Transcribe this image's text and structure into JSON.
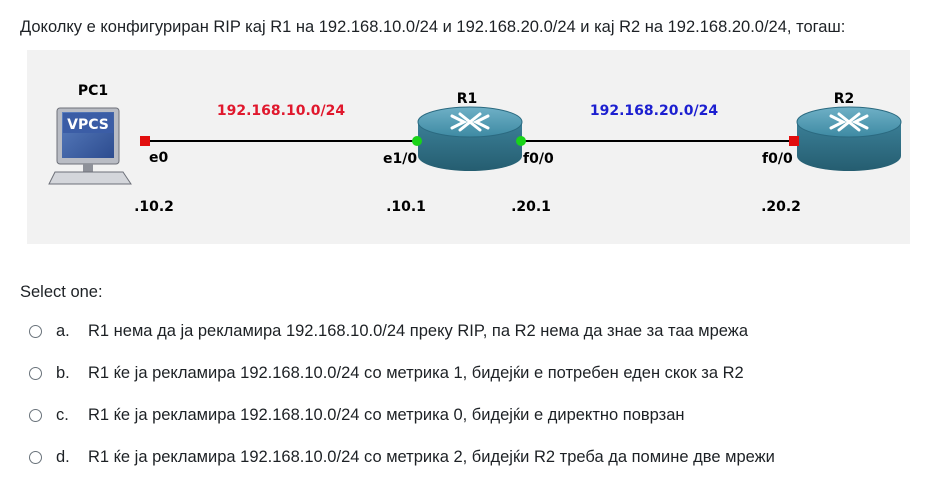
{
  "question": {
    "text": "Доколку е конфигуриран RIP кај R1 на 192.168.10.0/24 и 192.168.20.0/24 и кај R2 на 192.168.20.0/24, тогаш:"
  },
  "diagram": {
    "pc1": {
      "name": "PC1",
      "badge": "VPCS",
      "interface": "e0",
      "address": ".10.2"
    },
    "r1": {
      "name": "R1",
      "interface_left": "e1/0",
      "interface_right": "f0/0",
      "address_left": ".10.1",
      "address_right": ".20.1"
    },
    "r2": {
      "name": "R2",
      "interface": "f0/0",
      "address": ".20.2"
    },
    "net_left": "192.168.10.0/24",
    "net_right": "192.168.20.0/24",
    "colors": {
      "net_left": "#e0182d",
      "net_right": "#1c1fd0",
      "link_up": "#19d319",
      "link_down": "#e20e0e",
      "router": "#3b7f97"
    }
  },
  "select_label": "Select one:",
  "answers": [
    {
      "letter": "a.",
      "text": "R1 нема да ја рекламира 192.168.10.0/24 преку RIP, па R2 нема да знае за таа мрежа"
    },
    {
      "letter": "b.",
      "text": "R1 ќе ја рекламира 192.168.10.0/24 со метрика 1, бидејќи е потребен еден скок за R2"
    },
    {
      "letter": "c.",
      "text": "R1 ќе ја рекламира 192.168.10.0/24 со метрика 0, бидејќи е директно поврзан"
    },
    {
      "letter": "d.",
      "text": "R1 ќе ја рекламира 192.168.10.0/24 со метрика 2, бидејќи R2 треба да помине две мрежи"
    }
  ]
}
